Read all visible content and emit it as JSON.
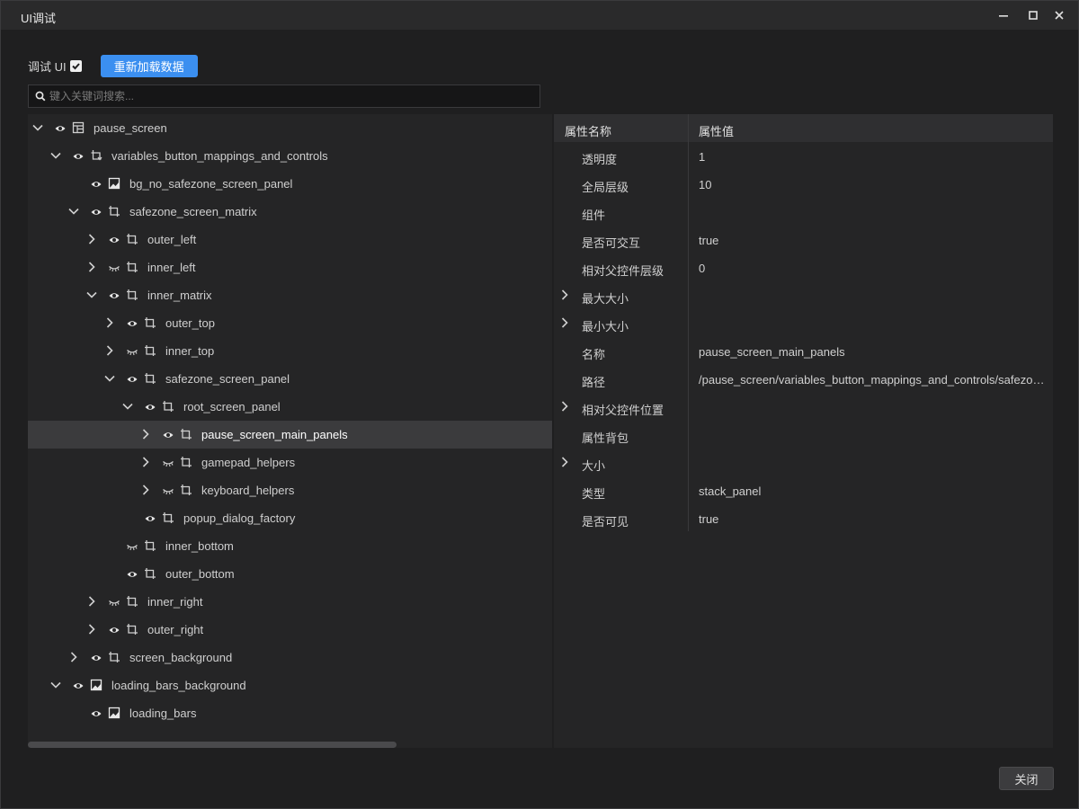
{
  "window": {
    "title": "UI调试"
  },
  "toolbar": {
    "debug_ui_label": "调试 UI",
    "debug_ui_checked": true,
    "reload_button": "重新加载数据"
  },
  "search": {
    "placeholder": "键入关键词搜索...",
    "value": ""
  },
  "tree": {
    "items": [
      {
        "label": "pause_screen",
        "depth": 0,
        "expander": "expanded",
        "visible": true,
        "type_icon": "screen-layout-icon"
      },
      {
        "label": "variables_button_mappings_and_controls",
        "depth": 1,
        "expander": "expanded",
        "visible": true,
        "type_icon": "variables-icon"
      },
      {
        "label": "bg_no_safezone_screen_panel",
        "depth": 2,
        "expander": "none",
        "visible": true,
        "type_icon": "image-icon"
      },
      {
        "label": "safezone_screen_matrix",
        "depth": 2,
        "expander": "expanded",
        "visible": true,
        "type_icon": "panel-icon"
      },
      {
        "label": "outer_left",
        "depth": 3,
        "expander": "collapsed",
        "visible": true,
        "type_icon": "panel-icon"
      },
      {
        "label": "inner_left",
        "depth": 3,
        "expander": "collapsed",
        "visible": false,
        "type_icon": "panel-icon"
      },
      {
        "label": "inner_matrix",
        "depth": 3,
        "expander": "expanded",
        "visible": true,
        "type_icon": "panel-icon"
      },
      {
        "label": "outer_top",
        "depth": 4,
        "expander": "collapsed",
        "visible": true,
        "type_icon": "panel-icon"
      },
      {
        "label": "inner_top",
        "depth": 4,
        "expander": "collapsed",
        "visible": false,
        "type_icon": "panel-icon"
      },
      {
        "label": "safezone_screen_panel",
        "depth": 4,
        "expander": "expanded",
        "visible": true,
        "type_icon": "panel-icon"
      },
      {
        "label": "root_screen_panel",
        "depth": 5,
        "expander": "expanded",
        "visible": true,
        "type_icon": "panel-icon"
      },
      {
        "label": "pause_screen_main_panels",
        "depth": 6,
        "expander": "collapsed",
        "visible": true,
        "type_icon": "panel-icon",
        "selected": true
      },
      {
        "label": "gamepad_helpers",
        "depth": 6,
        "expander": "collapsed",
        "visible": false,
        "type_icon": "panel-icon"
      },
      {
        "label": "keyboard_helpers",
        "depth": 6,
        "expander": "collapsed",
        "visible": false,
        "type_icon": "panel-icon"
      },
      {
        "label": "popup_dialog_factory",
        "depth": 5,
        "expander": "none",
        "visible": true,
        "type_icon": "panel-icon"
      },
      {
        "label": "inner_bottom",
        "depth": 4,
        "expander": "none",
        "visible": false,
        "type_icon": "panel-icon"
      },
      {
        "label": "outer_bottom",
        "depth": 4,
        "expander": "none",
        "visible": true,
        "type_icon": "panel-icon"
      },
      {
        "label": "inner_right",
        "depth": 3,
        "expander": "collapsed",
        "visible": false,
        "type_icon": "panel-icon"
      },
      {
        "label": "outer_right",
        "depth": 3,
        "expander": "collapsed",
        "visible": true,
        "type_icon": "panel-icon"
      },
      {
        "label": "screen_background",
        "depth": 2,
        "expander": "collapsed",
        "visible": true,
        "type_icon": "panel-icon"
      },
      {
        "label": "loading_bars_background",
        "depth": 1,
        "expander": "expanded",
        "visible": true,
        "type_icon": "image-icon"
      },
      {
        "label": "loading_bars",
        "depth": 2,
        "expander": "none",
        "visible": true,
        "type_icon": "image-icon"
      }
    ]
  },
  "properties": {
    "header_name": "属性名称",
    "header_value": "属性值",
    "rows": [
      {
        "name": "透明度",
        "value": "1",
        "expandable": false
      },
      {
        "name": "全局层级",
        "value": "10",
        "expandable": false
      },
      {
        "name": "组件",
        "value": "",
        "expandable": false
      },
      {
        "name": "是否可交互",
        "value": "true",
        "expandable": false
      },
      {
        "name": "相对父控件层级",
        "value": "0",
        "expandable": false
      },
      {
        "name": "最大大小",
        "value": "",
        "expandable": true
      },
      {
        "name": "最小大小",
        "value": "",
        "expandable": true
      },
      {
        "name": "名称",
        "value": "pause_screen_main_panels",
        "expandable": false
      },
      {
        "name": "路径",
        "value": "/pause_screen/variables_button_mappings_and_controls/safezone_screen_matrix/inner_matrix/safezone_screen_panel/root_screen_panel/pause_screen_main_panels",
        "expandable": false
      },
      {
        "name": "相对父控件位置",
        "value": "",
        "expandable": true
      },
      {
        "name": "属性背包",
        "value": "",
        "expandable": false
      },
      {
        "name": "大小",
        "value": "",
        "expandable": true
      },
      {
        "name": "类型",
        "value": "stack_panel",
        "expandable": false
      },
      {
        "name": "是否可见",
        "value": "true",
        "expandable": false
      }
    ]
  },
  "footer": {
    "close_button": "关闭"
  }
}
